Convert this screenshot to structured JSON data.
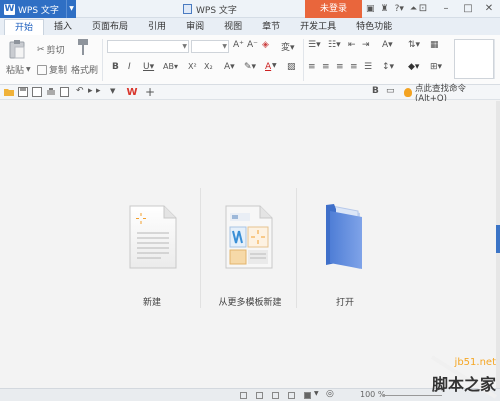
{
  "app": {
    "name": "WPS 文字",
    "window_title": "WPS 文字",
    "login_label": "未登录"
  },
  "tabs": [
    {
      "label": "开始",
      "active": true
    },
    {
      "label": "插入"
    },
    {
      "label": "页面布局"
    },
    {
      "label": "引用"
    },
    {
      "label": "审阅"
    },
    {
      "label": "视图"
    },
    {
      "label": "章节"
    },
    {
      "label": "开发工具"
    },
    {
      "label": "特色功能"
    }
  ],
  "ribbon": {
    "paste_label": "粘贴",
    "cut_label": "剪切",
    "copy_label": "复制",
    "format_painter_label": "格式刷"
  },
  "quick_access": {
    "command_search_label": "点此查找命令 (Alt+Q)"
  },
  "start_page": {
    "new_label": "新建",
    "new_from_template_label": "从更多模板新建",
    "open_label": "打开"
  },
  "status": {
    "zoom_text": "100 %"
  },
  "watermark": {
    "site": "jb51.net",
    "brand": "脚本之家"
  },
  "colors": {
    "accent": "#2f6fc4",
    "login": "#e9663c",
    "folder": "#5b86d9"
  }
}
